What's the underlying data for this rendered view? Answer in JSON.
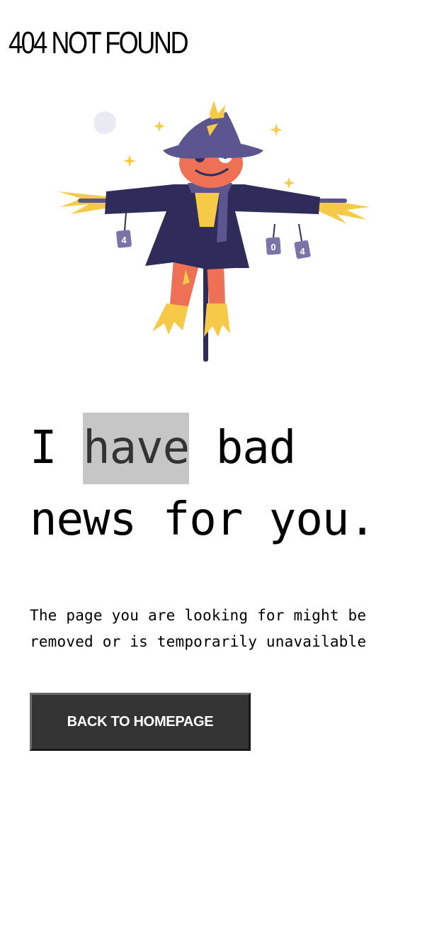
{
  "header": {
    "title": "404 NOT FOUND"
  },
  "hero": {
    "illustration": "scarecrow-illustration",
    "can_labels": [
      "4",
      "0",
      "4"
    ]
  },
  "main": {
    "headline_before": "I ",
    "headline_highlight": "have",
    "headline_after": " bad news for you.",
    "description": "The page you are looking for might be removed or is temporarily unavailable",
    "button_label": "BACK TO HOMEPAGE"
  },
  "colors": {
    "accent_highlight": "#c6c6c6",
    "button_bg": "#333333",
    "scarecrow_navy": "#2f2c5a",
    "scarecrow_orange": "#ef7155",
    "straw_yellow": "#f7c948",
    "hat_purple": "#5b5590"
  }
}
